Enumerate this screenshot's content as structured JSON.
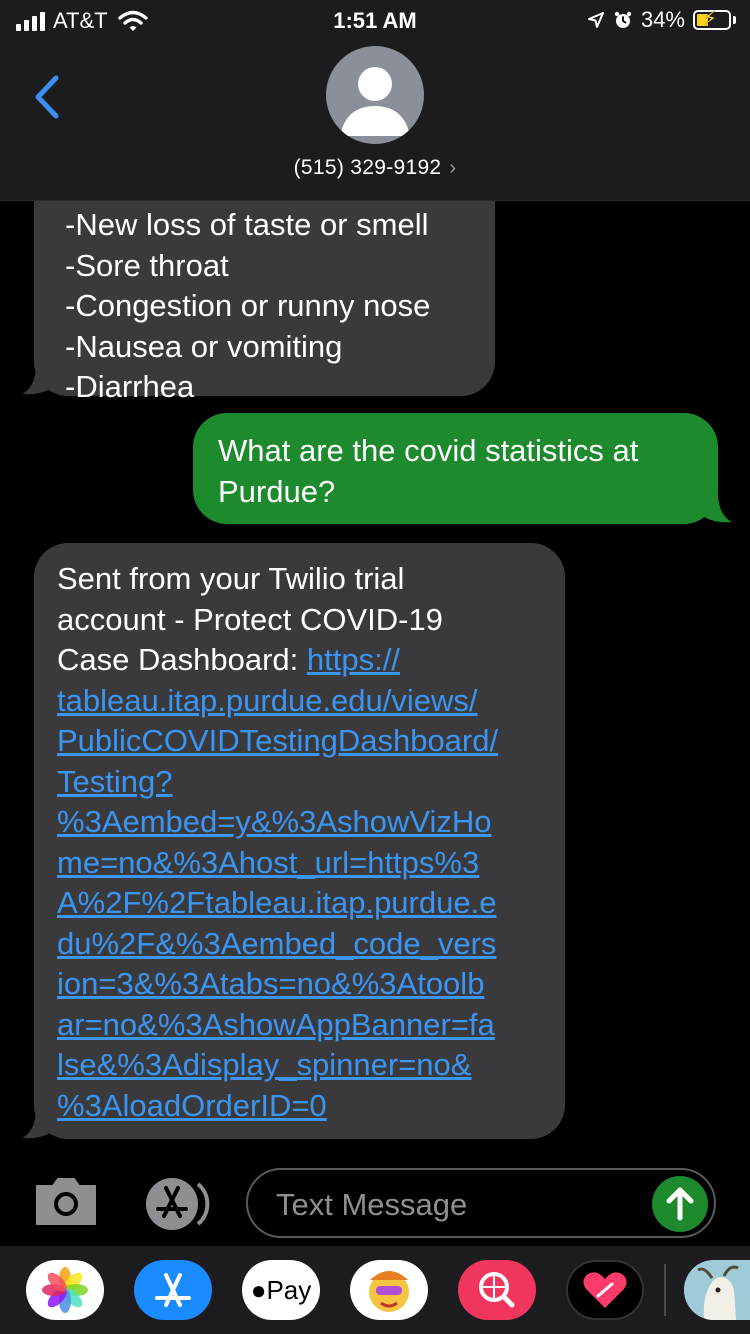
{
  "status_bar": {
    "carrier": "AT&T",
    "time": "1:51 AM",
    "battery_percent": "34%",
    "battery_level": 0.34,
    "icons": [
      "signal-icon",
      "wifi-icon",
      "location-arrow-icon",
      "alarm-icon",
      "battery-charging-icon"
    ]
  },
  "header": {
    "contact": "(515) 329-9192",
    "chevron": "›",
    "back_icon": "chevron-left-icon",
    "avatar_icon": "person-silhouette-icon"
  },
  "messages": [
    {
      "direction": "incoming",
      "lines": [
        "-New loss of taste or smell",
        "-Sore throat",
        "-Congestion or runny nose",
        "-Nausea or vomiting",
        "-Diarrhea"
      ]
    },
    {
      "direction": "outgoing",
      "lines": [
        "What are the covid statistics at",
        "Purdue?"
      ]
    },
    {
      "direction": "incoming",
      "text_lines": [
        "Sent from your Twilio trial",
        "account - Protect COVID-19",
        "Case Dashboard: "
      ],
      "link_lines": [
        "https://",
        "tableau.itap.purdue.edu/views/",
        "PublicCOVIDTestingDashboard/",
        "Testing?",
        "%3Aembed=y&%3AshowVizHo",
        "me=no&%3Ahost_url=https%3",
        "A%2F%2Ftableau.itap.purdue.e",
        "du%2F&%3Aembed_code_vers",
        "ion=3&%3Atabs=no&%3Atoolb",
        "ar=no&%3AshowAppBanner=fa",
        "lse&%3Adisplay_spinner=no&",
        "%3AloadOrderID=0"
      ]
    }
  ],
  "input_bar": {
    "placeholder": "Text Message",
    "camera_icon": "camera-icon",
    "apps_icon": "app-store-icon",
    "send_icon": "send-arrow-up-icon"
  },
  "app_drawer": {
    "apps": [
      {
        "name": "photos",
        "icon": "photos-icon"
      },
      {
        "name": "app-store",
        "icon": "app-store-icon"
      },
      {
        "name": "apple-pay",
        "label": "Pay",
        "icon": "apple-pay-icon"
      },
      {
        "name": "memoji",
        "icon": "memoji-icon"
      },
      {
        "name": "search-images",
        "icon": "image-search-icon"
      },
      {
        "name": "digital-touch",
        "icon": "digital-touch-heart-icon"
      },
      {
        "name": "goat-game",
        "icon": "goat-icon"
      }
    ]
  },
  "colors": {
    "outgoing_bubble": "#1d8a2e",
    "incoming_bubble": "#3a3a3c",
    "link": "#3b95f2",
    "header_bg": "#1c1c1e",
    "back_chevron": "#3b8ff0"
  }
}
